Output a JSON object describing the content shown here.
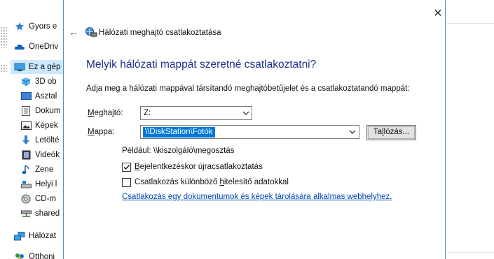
{
  "sidebar": {
    "items": [
      {
        "label": "Gyors e",
        "icon": "star-icon"
      },
      {
        "label": "OneDriv",
        "icon": "cloud-icon"
      },
      {
        "label": "Ez a gép",
        "icon": "computer-icon"
      },
      {
        "label": "3D ob",
        "icon": "3d-objects-icon"
      },
      {
        "label": "Asztal",
        "icon": "desktop-icon"
      },
      {
        "label": "Dokum",
        "icon": "documents-icon"
      },
      {
        "label": "Képek",
        "icon": "pictures-icon"
      },
      {
        "label": "Letölté",
        "icon": "downloads-icon"
      },
      {
        "label": "Videók",
        "icon": "videos-icon"
      },
      {
        "label": "Zene",
        "icon": "music-icon"
      },
      {
        "label": "Helyi l",
        "icon": "local-disk-icon"
      },
      {
        "label": "CD-m",
        "icon": "cd-drive-icon"
      },
      {
        "label": "shared",
        "icon": "network-drive-icon"
      },
      {
        "label": "Hálózat",
        "icon": "network-icon"
      },
      {
        "label": "Otthoni",
        "icon": "homegroup-icon"
      }
    ]
  },
  "dialog": {
    "title": "Hálózati meghajtó csatlakoztatása",
    "heading": "Melyik hálózati mappát szeretné csatlakoztatni?",
    "instruction": "Adja meg a hálózati mappával társítandó meghajtóbetűjelet és a csatlakoztatandó mappát:",
    "drive_label_first": "M",
    "drive_label_rest": "eghajtó:",
    "drive_value": "Z:",
    "folder_label_first": "M",
    "folder_label_rest": "appa:",
    "folder_value": "\\\\DiskStation\\Fotók",
    "browse_pre": "Ta",
    "browse_u": "l",
    "browse_post": "lózás...",
    "example": "Például: \\\\kiszolgáló\\megosztás",
    "reconnect_u": "B",
    "reconnect_rest": "ejelentkezéskor újracsatlakoztatás",
    "reconnect_checked": true,
    "credentials_pre": "Csatlakozás különböző ",
    "credentials_u": "h",
    "credentials_post": "itelesítő adatokkal",
    "credentials_checked": false,
    "link": "Csatlakozás egy dokumentumok és képek tárolására alkalmas webhelyhez",
    "link_suffix": ".",
    "close_symbol": "✕",
    "back_symbol": "←"
  },
  "colors": {
    "heading": "#1e3287",
    "selection": "#0078d7",
    "link": "#0046b4",
    "sidebar_selected": "#cce8ff"
  }
}
